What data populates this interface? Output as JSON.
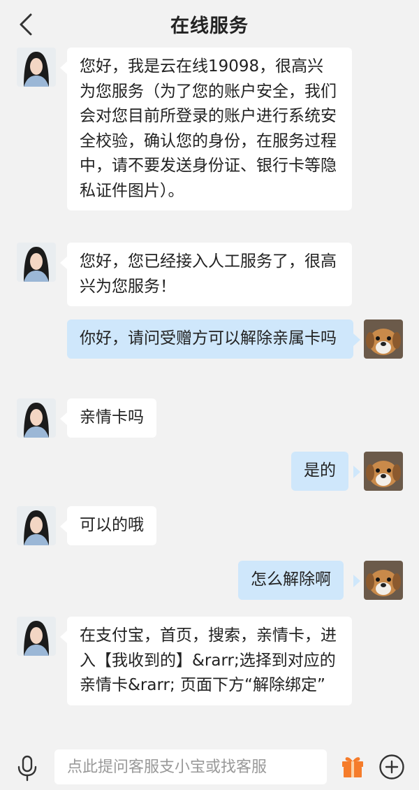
{
  "header": {
    "title": "在线服务",
    "back_icon": "chevron-left-icon"
  },
  "messages": [
    {
      "sender": "agent",
      "text": "您好，我是云在线19098，很高兴为您服务（为了您的账户安全，我们会对您目前所登录的账户进行系统安全校验，确认您的身份，在服务过程中，请不要发送身份证、银行卡等隐私证件图片）。"
    },
    {
      "sender": "agent",
      "text": "您好，您已经接入人工服务了，很高兴为您服务！"
    },
    {
      "sender": "user",
      "text": "你好，请问受赠方可以解除亲属卡吗"
    },
    {
      "sender": "agent",
      "text": "亲情卡吗"
    },
    {
      "sender": "user",
      "text": "是的"
    },
    {
      "sender": "agent",
      "text": "可以的哦"
    },
    {
      "sender": "user",
      "text": "怎么解除啊"
    },
    {
      "sender": "agent",
      "text": "在支付宝，首页，搜索，亲情卡，进入【我收到的】&rarr;选择到对应的亲情卡&rarr; 页面下方“解除绑定”"
    }
  ],
  "input_bar": {
    "placeholder": "点此提问客服支小宝或找客服",
    "mic_icon": "microphone-icon",
    "gift_icon": "gift-icon",
    "plus_icon": "plus-circle-icon"
  },
  "colors": {
    "background": "#f2f2f2",
    "agent_bubble": "#ffffff",
    "user_bubble": "#cfe7fb",
    "gift_orange": "#f57c2b"
  }
}
